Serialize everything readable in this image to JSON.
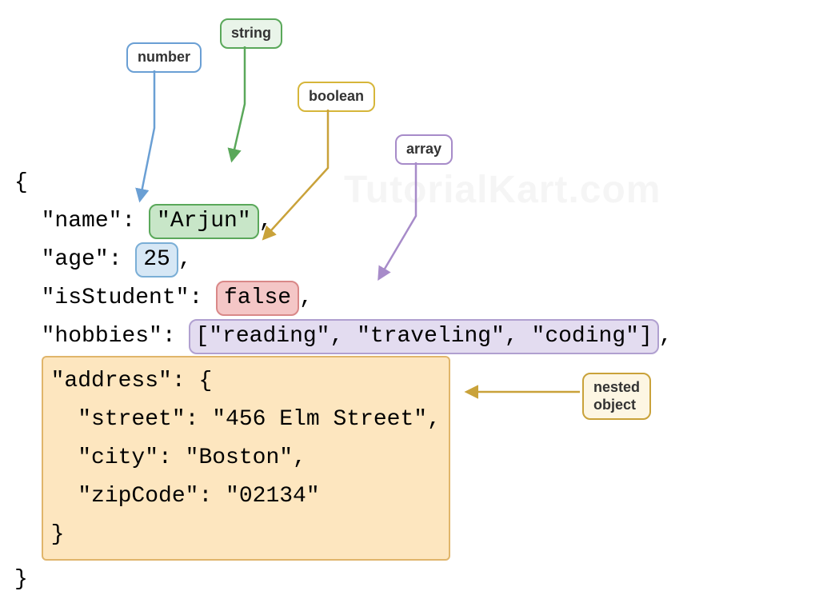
{
  "labels": {
    "number": "number",
    "string": "string",
    "boolean": "boolean",
    "array": "array",
    "nested": "nested\nobject"
  },
  "code": {
    "open_brace": "{",
    "close_brace": "}",
    "name_key": "\"name\": ",
    "name_val": "\"Arjun\"",
    "age_key": "\"age\": ",
    "age_val": "25",
    "student_key": "\"isStudent\": ",
    "student_val": "false",
    "hobbies_key": "\"hobbies\": ",
    "hobbies_val": "[\"reading\", \"traveling\", \"coding\"]",
    "address_block": "\"address\": {\n  \"street\": \"456 Elm Street\",\n  \"city\": \"Boston\",\n  \"zipCode\": \"02134\"\n}",
    "comma": ","
  },
  "watermark": "TutorialKart.com"
}
